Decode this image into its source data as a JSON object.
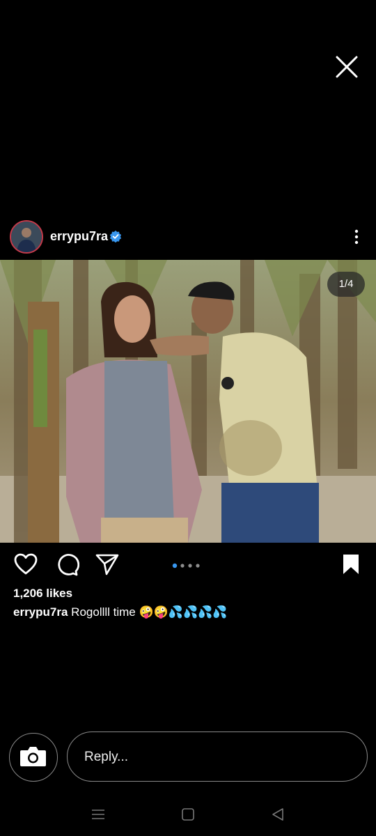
{
  "post": {
    "username": "errypu7ra",
    "counter": "1/4",
    "likes": "1,206 likes",
    "caption_user": "errypu7ra",
    "caption_text": "Rogollll time",
    "caption_emoji": "🤪🤪💦💦💦💦",
    "carousel": {
      "current": 1,
      "total": 4
    }
  },
  "reply": {
    "placeholder": "Reply..."
  },
  "icons": {
    "close": "close-icon",
    "verified": "verified-badge-icon",
    "more": "more-vertical-icon",
    "like": "heart-icon",
    "comment": "comment-icon",
    "share": "send-icon",
    "save": "bookmark-icon",
    "camera": "camera-icon",
    "nav_menu": "menu-icon",
    "nav_home": "home-square-icon",
    "nav_back": "back-triangle-icon"
  },
  "colors": {
    "background": "#000000",
    "verified": "#3897f0",
    "active_dot": "#3897f0",
    "avatar_ring": "#c33a4a"
  }
}
